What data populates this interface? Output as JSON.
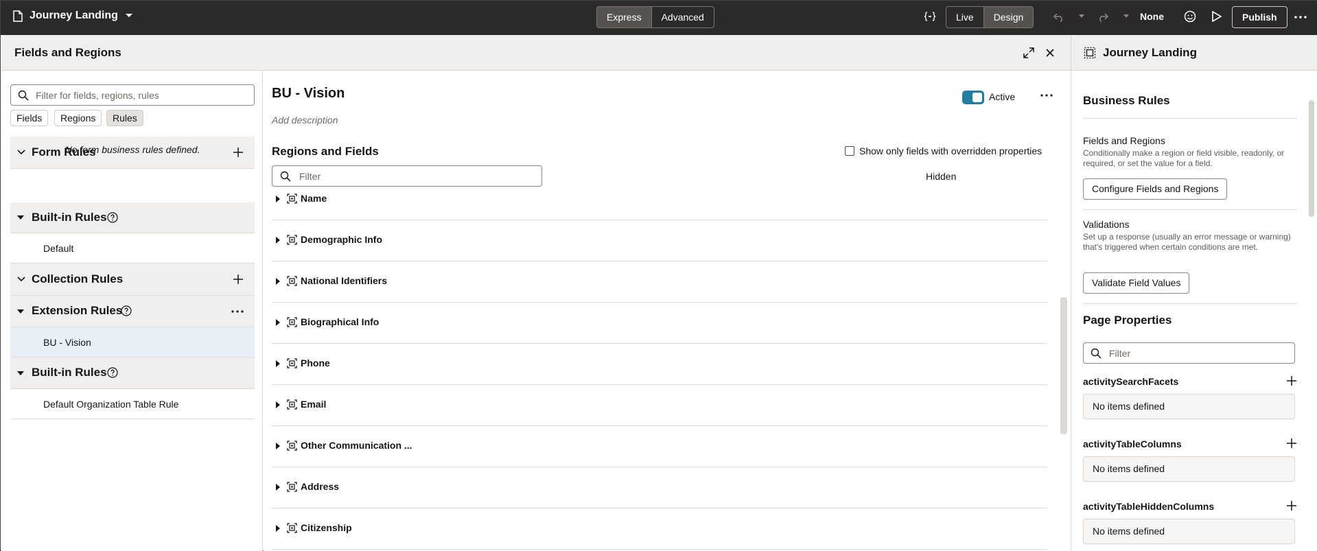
{
  "topbar": {
    "app_title": "Journey Landing",
    "mode_express": "Express",
    "mode_advanced": "Advanced",
    "view_live": "Live",
    "view_design": "Design",
    "none_label": "None",
    "publish_label": "Publish"
  },
  "modal": {
    "title": "Fields and Regions"
  },
  "left": {
    "search_placeholder": "Filter for fields, regions, rules",
    "chips": [
      "Fields",
      "Regions",
      "Rules"
    ],
    "form_rules": "Form Rules",
    "no_form_rules": "No form business rules defined.",
    "builtin_rules": "Built-in Rules",
    "default_item": "Default",
    "collection_rules": "Collection Rules",
    "extension_rules": "Extension Rules",
    "bu_vision": "BU - Vision",
    "builtin_rules_2": "Built-in Rules",
    "default_org_rule": "Default Organization Table Rule"
  },
  "main": {
    "rule_name": "BU - Vision",
    "add_description": "Add description",
    "active_label": "Active",
    "regions_title": "Regions and Fields",
    "show_overridden": "Show only fields with overridden properties",
    "filter_placeholder": "Filter",
    "hidden_col": "Hidden",
    "regions": [
      "Name",
      "Demographic Info",
      "National Identifiers",
      "Biographical Info",
      "Phone",
      "Email",
      "Other Communication ...",
      "Address",
      "Citizenship"
    ]
  },
  "right": {
    "title": "Journey Landing",
    "business_rules": "Business Rules",
    "fields_regions": "Fields and Regions",
    "fields_regions_desc": "Conditionally make a region or field visible, readonly, or required, or set the value for a field.",
    "configure_btn": "Configure Fields and Regions",
    "validations": "Validations",
    "validations_desc": "Set up a response (usually an error message or warning) that's triggered when certain conditions are met.",
    "validate_btn": "Validate Field Values",
    "page_properties": "Page Properties",
    "filter_placeholder": "Filter",
    "props": [
      "activitySearchFacets",
      "activityTableColumns",
      "activityTableHiddenColumns"
    ],
    "no_items": "No items defined"
  }
}
